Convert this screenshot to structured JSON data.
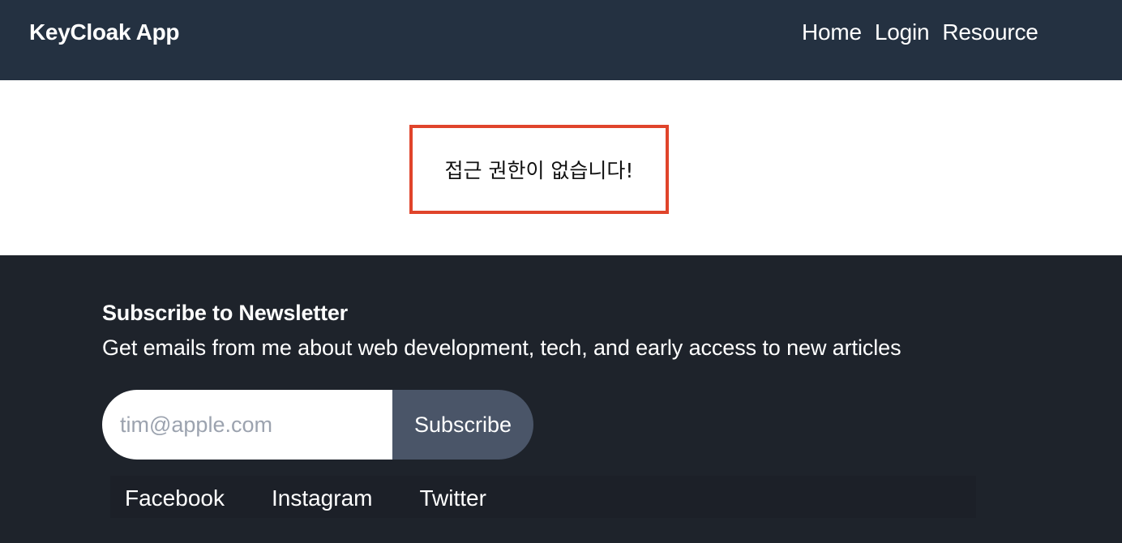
{
  "header": {
    "brand": "KeyCloak App",
    "nav": [
      "Home",
      "Login",
      "Resource"
    ]
  },
  "main": {
    "message": "접근 권한이 없습니다!"
  },
  "footer": {
    "newsletter_title": "Subscribe to Newsletter",
    "newsletter_subtitle": "Get emails from me about web development, tech, and early access to new articles",
    "email_placeholder": "tim@apple.com",
    "subscribe_label": "Subscribe",
    "social": [
      "Facebook",
      "Instagram",
      "Twitter"
    ]
  },
  "colors": {
    "header_bg": "#243141",
    "footer_bg": "#1e232b",
    "notice_border": "#e0442b",
    "button_bg": "#4a5568"
  }
}
